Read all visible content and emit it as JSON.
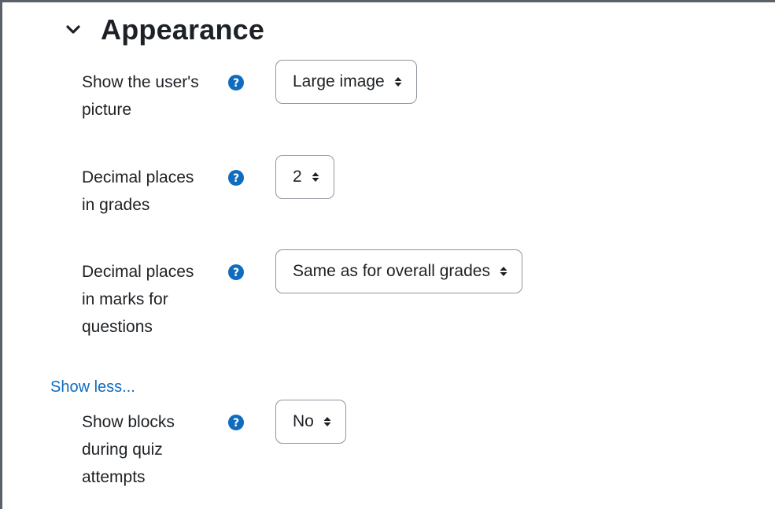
{
  "section": {
    "title": "Appearance",
    "toggle_icon": "chevron-down-icon"
  },
  "settings": [
    {
      "label_lines": [
        "Show the user's",
        "picture"
      ],
      "help_icon": "question-circle-icon",
      "value": "Large image"
    },
    {
      "label_lines": [
        "Decimal places",
        "in grades"
      ],
      "help_icon": "question-circle-icon",
      "value": "2"
    },
    {
      "label_lines": [
        "Decimal places",
        "in marks for",
        "questions"
      ],
      "help_icon": "question-circle-icon",
      "value": "Same as for overall grades"
    },
    {
      "label_lines": [
        "Show blocks",
        "during quiz",
        "attempts"
      ],
      "help_icon": "question-circle-icon",
      "value": "No"
    }
  ],
  "show_less_link": "Show less...",
  "colors": {
    "link": "#0f6cbf",
    "help_icon": "#0f6cbf",
    "text": "#1d2125",
    "select_border": "#8f959e",
    "frame": "#5a6168"
  }
}
